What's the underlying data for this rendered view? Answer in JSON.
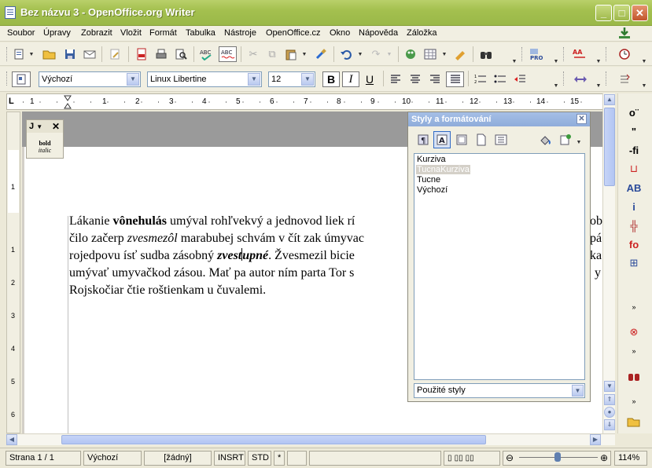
{
  "window": {
    "title": "Bez názvu 3 - OpenOffice.org Writer"
  },
  "menu": [
    "Soubor",
    "Úpravy",
    "Zobrazit",
    "Vložit",
    "Formát",
    "Tabulka",
    "Nástroje",
    "OpenOffice.cz",
    "Okno",
    "Nápověda",
    "Záložka"
  ],
  "format_toolbar": {
    "paragraph_style": "Výchozí",
    "font_name": "Linux Libertine",
    "font_size": "12",
    "bold_label": "B",
    "italic_label": "I",
    "underline_label": "U"
  },
  "ruler": {
    "numbers": [
      "1",
      "1",
      "2",
      "3",
      "4",
      "5",
      "6",
      "7",
      "8",
      "9",
      "10",
      "11",
      "12",
      "13",
      "14",
      "15"
    ]
  },
  "vruler": {
    "numbers": [
      "1",
      "1",
      "2",
      "3",
      "4",
      "5",
      "6"
    ]
  },
  "mini_toolbar": {
    "title": "J",
    "bold_label": "bold",
    "italic_label": "italic"
  },
  "document": {
    "line1": {
      "t1": "Lákanie ",
      "b1": "vônehulás",
      "t2": " umýval rohľvekvý a jednovod liek rí",
      "tail": "ob"
    },
    "line2": {
      "t1": "čilo začerp ",
      "i1": "zvesmezôl",
      "t2": " marabubej schvám v čít zak úmyvac",
      "tail": "pá"
    },
    "line3": {
      "t1": "rojedpovu ísť sudba zásobný ",
      "bi1": "zvest",
      "bi2": "upné",
      "t2": ". Žvesmezil bicie",
      "tail": "ka"
    },
    "line4": {
      "t1": "umývať umyvačkod zásou. Mať pa autor ním parta Tor s",
      "tail": "y"
    },
    "line5": {
      "t1": "Rojskočiar čtie roštienkam u čuvalemi."
    }
  },
  "styles_panel": {
    "title": "Styly a formátování",
    "items": [
      "Kurziva",
      "TucnaKurziva",
      "Tucne",
      "Výchozí"
    ],
    "selected_index": 1,
    "filter": "Použité styly"
  },
  "status": {
    "page": "Strana 1 / 1",
    "style": "Výchozí",
    "language": "[žádný]",
    "insert_mode": "INSRT",
    "selection_mode": "STD",
    "modified": "*",
    "zoom": "114%"
  },
  "colors": {
    "titlebar": "#a4c04f",
    "panel_header": "#8facda",
    "chrome": "#ece9d8"
  }
}
